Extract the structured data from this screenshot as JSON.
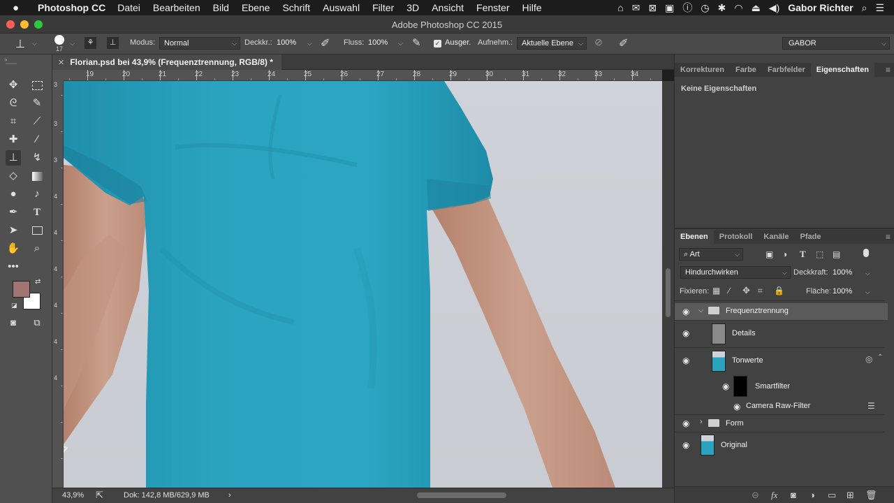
{
  "menubar": {
    "app_name": "Photoshop CC",
    "menus": [
      "Datei",
      "Bearbeiten",
      "Bild",
      "Ebene",
      "Schrift",
      "Auswahl",
      "Filter",
      "3D",
      "Ansicht",
      "Fenster",
      "Hilfe"
    ],
    "user": "Gabor Richter"
  },
  "window": {
    "title": "Adobe Photoshop CC 2015"
  },
  "options_bar": {
    "brush_size": "17",
    "mode_label": "Modus:",
    "mode_value": "Normal",
    "opacity_label": "Deckkr.:",
    "opacity_value": "100%",
    "flow_label": "Fluss:",
    "flow_value": "100%",
    "aligned_label": "Ausger.",
    "sample_label": "Aufnehm.:",
    "sample_value": "Aktuelle Ebene",
    "workspace": "GABOR"
  },
  "document": {
    "tab_title": "Florian.psd bei 43,9% (Frequenztrennung, RGB/8) *",
    "ruler_h": [
      "19",
      "20",
      "21",
      "22",
      "23",
      "24",
      "25",
      "26",
      "27",
      "28",
      "29",
      "30",
      "31",
      "32",
      "33",
      "34"
    ],
    "ruler_v": [
      "3",
      "3",
      "3",
      "4",
      "4",
      "4",
      "4",
      "4",
      "4"
    ],
    "zoom": "43,9%",
    "doc_info": "Dok: 142,8 MB/629,9 MB"
  },
  "panels": {
    "top_tabs": [
      "Korrekturen",
      "Farbe",
      "Farbfelder",
      "Eigenschaften"
    ],
    "properties_empty": "Keine Eigenschaften",
    "layers_tabs": [
      "Ebenen",
      "Protokoll",
      "Kanäle",
      "Pfade"
    ],
    "filter_kind": "Art",
    "blend_mode": "Hindurchwirken",
    "opacity_label": "Deckkraft:",
    "opacity_value": "100%",
    "lock_label": "Fixieren:",
    "fill_label": "Fläche:",
    "fill_value": "100%",
    "layers": [
      {
        "name": "Frequenztrennung",
        "type": "group-open",
        "selected": true
      },
      {
        "name": "Details",
        "type": "layer"
      },
      {
        "name": "Tonwerte",
        "type": "smart-object"
      },
      {
        "name": "Smartfilter",
        "type": "smart-filter"
      },
      {
        "name": "Camera Raw-Filter",
        "type": "filter"
      },
      {
        "name": "Form",
        "type": "group-closed"
      },
      {
        "name": "Original",
        "type": "smart-object"
      }
    ]
  },
  "colors": {
    "foreground": "#a07470",
    "background": "#ffffff",
    "shirt": "#2aa3bf",
    "backdrop": "#cdd0d6",
    "skin": "#c89a86"
  }
}
